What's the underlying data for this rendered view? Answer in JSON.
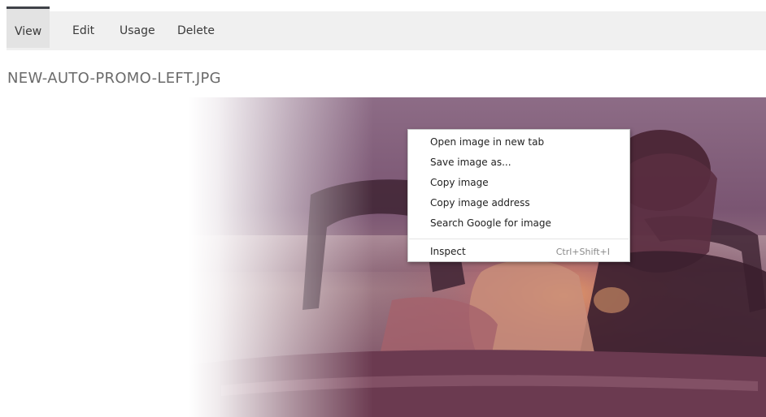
{
  "tabs": [
    {
      "label": "View",
      "active": true
    },
    {
      "label": "Edit",
      "active": false
    },
    {
      "label": "Usage",
      "active": false
    },
    {
      "label": "Delete",
      "active": false
    }
  ],
  "page": {
    "title": "NEW-AUTO-PROMO-LEFT.JPG"
  },
  "context_menu": {
    "items": [
      {
        "label": "Open image in new tab"
      },
      {
        "label": "Save image as..."
      },
      {
        "label": "Copy image"
      },
      {
        "label": "Copy image address"
      },
      {
        "label": "Search Google for image"
      },
      {
        "label": "Inspect",
        "shortcut": "Ctrl+Shift+I"
      }
    ]
  },
  "colors": {
    "tab_bar_bg": "#f0f0f0",
    "active_tab_bg": "#e3e3e3",
    "active_tab_indicator": "#3f4248",
    "title_text": "#6b6b6b",
    "photo_tint": "#6b3a50"
  }
}
